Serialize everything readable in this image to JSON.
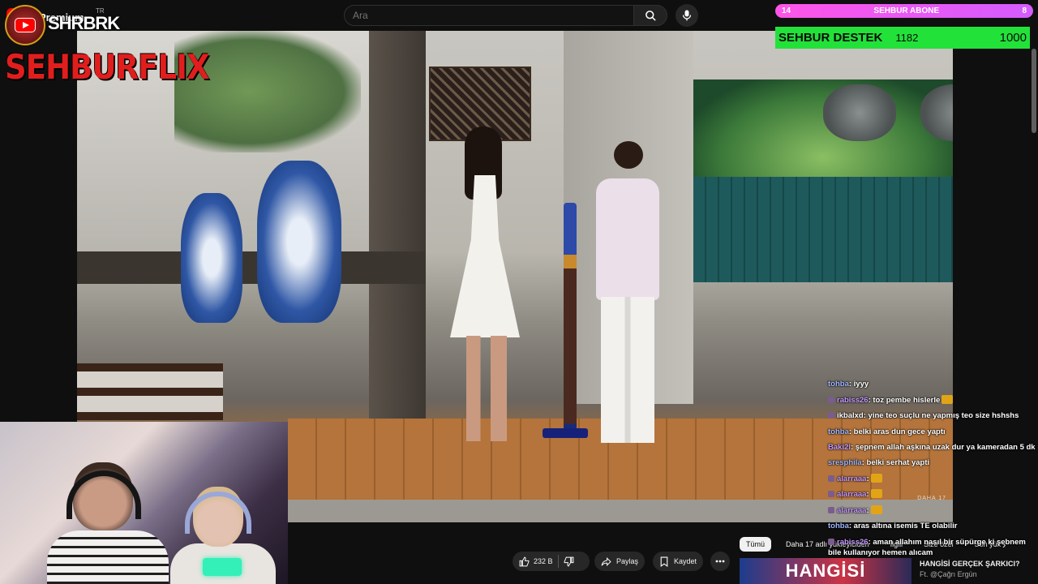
{
  "header": {
    "brand": "Premium",
    "region": "TR",
    "search_placeholder": "Ara"
  },
  "overlay": {
    "channel_short": "SHRBRK",
    "channel_logo": "SEHBURFLIX"
  },
  "subscriber_bar": {
    "left_value": "14",
    "label": "SEHBUR ABONE",
    "right_value": "8"
  },
  "support_bar": {
    "title": "SEHBUR DESTEK",
    "count": "1182",
    "goal": "1000"
  },
  "video": {
    "watermark": "DAHA 17"
  },
  "actions": {
    "like_count": "232 B",
    "share_label": "Paylaş",
    "save_label": "Kaydet"
  },
  "chat": {
    "messages": [
      {
        "user": "tohba",
        "text": ": iyyy",
        "user_color": "#9fb8ff"
      },
      {
        "user": "rabiss26",
        "text": ": toz pembe hislerle",
        "user_color": "#c79bff"
      },
      {
        "user": "ikbalxd",
        "text": ": yine teo suçlu ne yapmış teo size hshshs",
        "user_color": "#ffffff"
      },
      {
        "user": "tohba",
        "text": ": belki aras dun gece yaptı",
        "user_color": "#9fb8ff"
      },
      {
        "user": "Baki2l",
        "text": ": şepnem allah aşkına uzak dur ya kameradan 5 dk",
        "user_color": "#c79bff"
      },
      {
        "user": "sresphila",
        "text": ": belki serhat yapti",
        "user_color": "#9fb8ff"
      },
      {
        "user": "alarraaa",
        "text": ":",
        "user_color": "#c79bff"
      },
      {
        "user": "alarraaa",
        "text": ":",
        "user_color": "#c79bff"
      },
      {
        "user": "alarraaa",
        "text": ":",
        "user_color": "#c79bff"
      },
      {
        "user": "tohba",
        "text": ": aras altına isemis TE olabilir",
        "user_color": "#9fb8ff"
      },
      {
        "user": "rabiss26",
        "text": ": aman allahım nasıl bir süpürge ki şebnem bile kullanıyor hemen alıcam",
        "user_color": "#c79bff"
      }
    ]
  },
  "chips": {
    "items": [
      "Tümü",
      "Daha 17 adlı yükleyiciden",
      "İlgili",
      "Size özel",
      "Son yük"
    ]
  },
  "recommendation": {
    "thumb_text": "HANGİSİ",
    "title": "HANGİSİ GERÇEK ŞARKICI?",
    "channel": "Ft. @Çağrı Ergün"
  }
}
